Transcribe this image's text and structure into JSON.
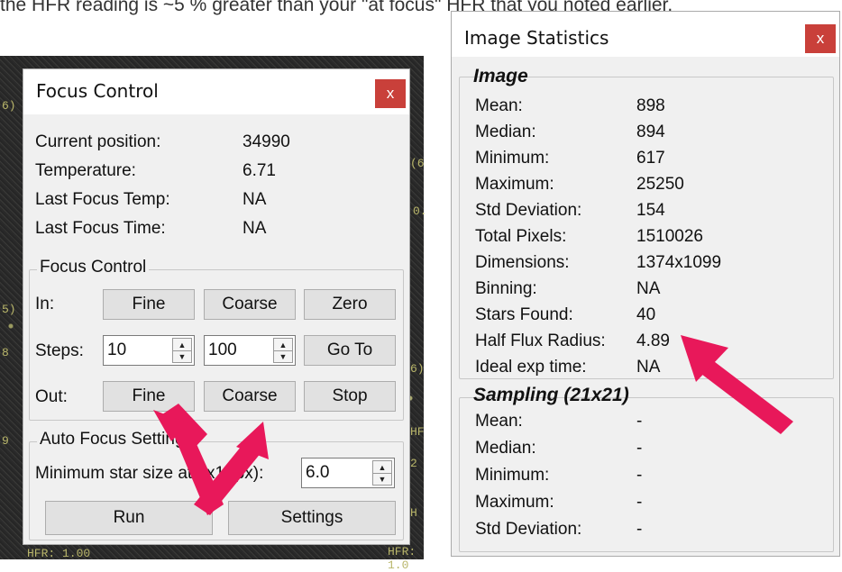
{
  "background_text": "the HFR reading is ~5 % greater than your \"at focus\" HFR that you noted earlier.",
  "focus_window": {
    "title": "Focus Control",
    "close_label": "x",
    "info": [
      {
        "label": "Current position:",
        "value": "34990"
      },
      {
        "label": "Temperature:",
        "value": "6.71"
      },
      {
        "label": "Last Focus Temp:",
        "value": "NA"
      },
      {
        "label": "Last Focus Time:",
        "value": "NA"
      }
    ],
    "control_group": {
      "title": "Focus Control",
      "in_label": "In:",
      "steps_label": "Steps:",
      "out_label": "Out:",
      "fine_label": "Fine",
      "coarse_label": "Coarse",
      "zero_label": "Zero",
      "goto_label": "Go To",
      "stop_label": "Stop",
      "fine_steps": "10",
      "coarse_steps": "100"
    },
    "auto_group": {
      "title": "Auto Focus Settings",
      "min_star_label": "Minimum star size at 1x1 (px):",
      "min_star_value": "6.0",
      "run_label": "Run",
      "settings_label": "Settings"
    }
  },
  "stats_window": {
    "title": "Image Statistics",
    "close_label": "x",
    "image_heading": "Image",
    "image_rows": [
      {
        "label": "Mean:",
        "value": "898"
      },
      {
        "label": "Median:",
        "value": "894"
      },
      {
        "label": "Minimum:",
        "value": "617"
      },
      {
        "label": "Maximum:",
        "value": "25250"
      },
      {
        "label": "Std Deviation:",
        "value": "154"
      },
      {
        "label": "Total Pixels:",
        "value": "1510026"
      },
      {
        "label": "Dimensions:",
        "value": "1374x1099"
      },
      {
        "label": "Binning:",
        "value": "NA"
      },
      {
        "label": "Stars Found:",
        "value": "40"
      },
      {
        "label": "Half Flux Radius:",
        "value": "4.89"
      },
      {
        "label": "Ideal exp time:",
        "value": "NA"
      }
    ],
    "sampling_heading": "Sampling (21x21)",
    "sampling_rows": [
      {
        "label": "Mean:",
        "value": "-"
      },
      {
        "label": "Median:",
        "value": "-"
      },
      {
        "label": "Minimum:",
        "value": "-"
      },
      {
        "label": "Maximum:",
        "value": "-"
      },
      {
        "label": "Std Deviation:",
        "value": "-"
      }
    ]
  },
  "annotation_color": "#e8185a"
}
